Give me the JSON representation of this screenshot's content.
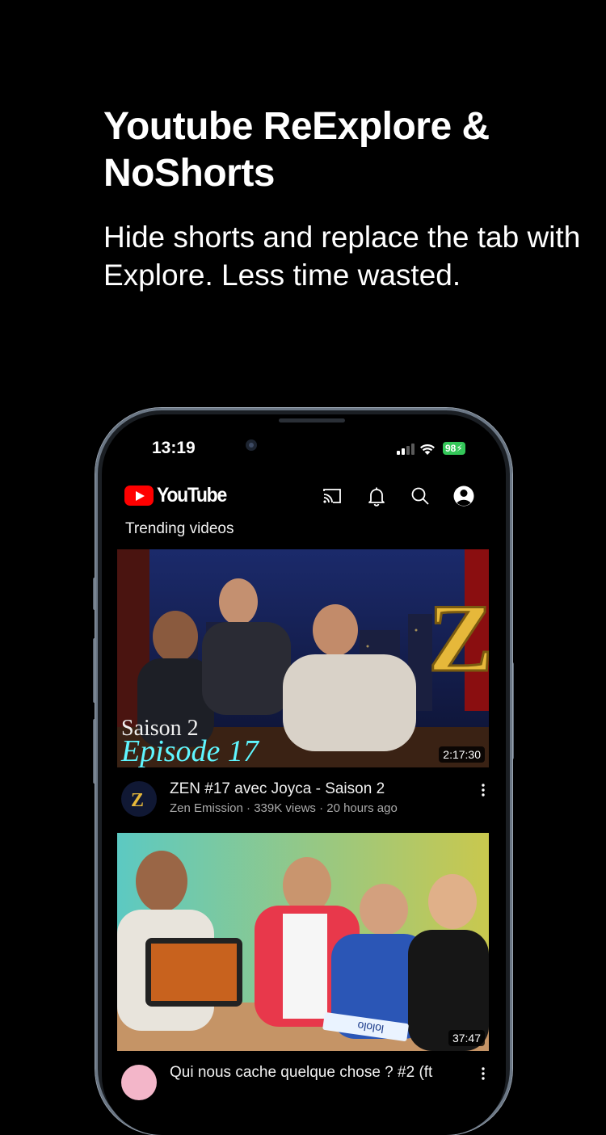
{
  "headline": {
    "title": "Youtube ReExplore & NoShorts",
    "subtitle": "Hide shorts and replace the tab with Explore.  Less time wasted."
  },
  "status_bar": {
    "time": "13:19",
    "battery": "98",
    "icons": [
      "cellular-signal-icon",
      "wifi-icon",
      "battery-charging-icon"
    ]
  },
  "app_bar": {
    "logo_text": "YouTube",
    "icons": [
      "cast-icon",
      "bell-icon",
      "search-icon",
      "account-icon"
    ]
  },
  "section": {
    "title": "Trending videos"
  },
  "videos": [
    {
      "title": "ZEN #17 avec Joyca - Saison 2",
      "meta": "Zen Emission · 339K views · 20 hours ago",
      "duration": "2:17:30",
      "thumb_text_1": "Saison 2",
      "thumb_text_2": "Episode 17",
      "avatar_letter": "Z"
    },
    {
      "title": "Qui nous cache quelque chose ? #2 (ft",
      "duration": "37:47",
      "thumb_text_1": "lololo"
    }
  ],
  "colors": {
    "accent": "#ff0000",
    "battery": "#34c759",
    "background": "#000000"
  }
}
